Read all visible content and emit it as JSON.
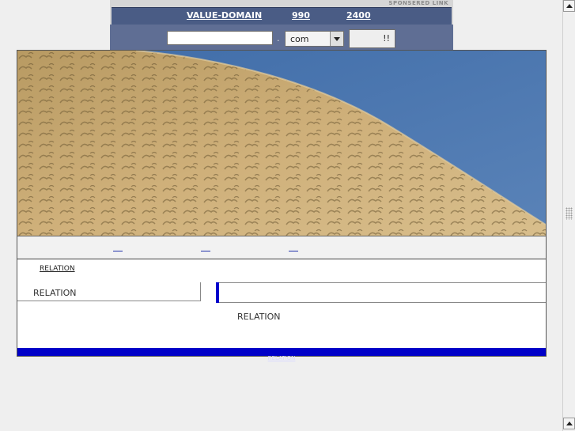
{
  "banner": {
    "sponsor_label": "SPONSERED LINK",
    "brand_link": "VALUE-DOMAIN",
    "price1_link": "990",
    "price2_link": "2400",
    "domain_input": {
      "value": "",
      "placeholder": ""
    },
    "dot": ".",
    "tld_selected": "com",
    "go_label": "!!"
  },
  "content": {
    "relation_top": "RELATION",
    "relation_side": "RELATION",
    "relation_center": "RELATION",
    "footer_link": "RELATION"
  },
  "colors": {
    "banner_bar": "#4a5c85",
    "banner_lower": "#5f6e94",
    "accent_blue": "#0000cc",
    "sky": "#4d76ad",
    "sand": "#c9a86b"
  }
}
